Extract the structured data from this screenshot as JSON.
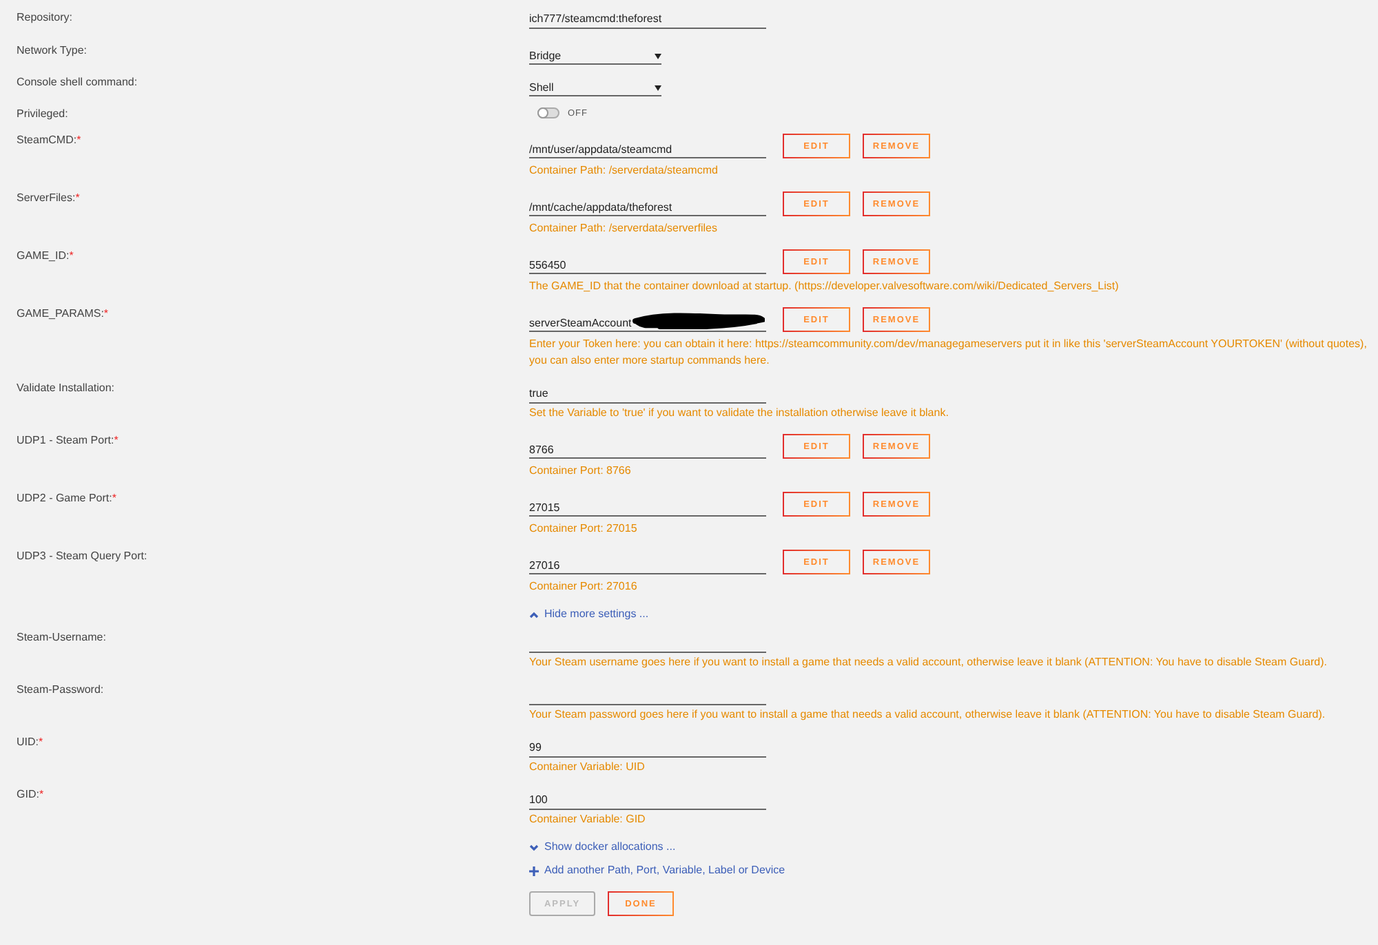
{
  "rows": [
    {
      "kind": "text",
      "label": "Repository:",
      "value": "ich777/steamcmd:theforest"
    },
    {
      "kind": "select",
      "label": "Network Type:",
      "value": "Bridge"
    },
    {
      "kind": "select",
      "label": "Console shell command:",
      "value": "Shell"
    },
    {
      "kind": "toggle",
      "label": "Privileged:",
      "on": false,
      "state_label": "OFF"
    },
    {
      "kind": "path",
      "label": "SteamCMD:",
      "required_mark": "*",
      "value": "/mnt/user/appdata/steamcmd",
      "help": "Container Path: /serverdata/steamcmd",
      "buttons": [
        "EDIT",
        "REMOVE"
      ]
    },
    {
      "kind": "path",
      "label": "ServerFiles:",
      "required_mark": "*",
      "value": "/mnt/cache/appdata/theforest",
      "help": "Container Path: /serverdata/serverfiles",
      "buttons": [
        "EDIT",
        "REMOVE"
      ]
    },
    {
      "kind": "path",
      "label": "GAME_ID:",
      "required_mark": "*",
      "value": "556450",
      "help": "The GAME_ID that the container download at startup. (https://developer.valvesoftware.com/wiki/Dedicated_Servers_List)",
      "buttons": [
        "EDIT",
        "REMOVE"
      ]
    },
    {
      "kind": "path",
      "label": "GAME_PARAMS:",
      "required_mark": "*",
      "value": "serverSteamAccount",
      "redacted": true,
      "help": "Enter your Token here: you can obtain it here: https://steamcommunity.com/dev/managegameservers put it in like this 'serverSteamAccount YOURTOKEN' (without quotes), you can also enter more startup commands here.",
      "buttons": [
        "EDIT",
        "REMOVE"
      ]
    },
    {
      "kind": "variable",
      "label": "Validate Installation:",
      "value": "true",
      "help": "Set the Variable to 'true' if you want to validate the installation otherwise leave it blank."
    },
    {
      "kind": "path",
      "label": "UDP1 - Steam Port:",
      "required_mark": "*",
      "value": "8766",
      "help": "Container Port: 8766",
      "buttons": [
        "EDIT",
        "REMOVE"
      ]
    },
    {
      "kind": "path",
      "label": "UDP2 - Game Port:",
      "required_mark": "*",
      "value": "27015",
      "help": "Container Port: 27015",
      "buttons": [
        "EDIT",
        "REMOVE"
      ]
    },
    {
      "kind": "path",
      "label": "UDP3 - Steam Query Port:",
      "value": "27016",
      "help": "Container Port: 27016",
      "buttons": [
        "EDIT",
        "REMOVE"
      ]
    },
    {
      "kind": "hide-link",
      "label": "Hide more settings ..."
    },
    {
      "kind": "variable",
      "label": "Steam-Username:",
      "help": "Your Steam username goes here if you want to install a game that needs a valid account, otherwise leave it blank (ATTENTION: You have to disable Steam Guard)."
    },
    {
      "kind": "variable",
      "label": "Steam-Password:",
      "help": "Your Steam password goes here if you want to install a game that needs a valid account, otherwise leave it blank (ATTENTION: You have to disable Steam Guard)."
    },
    {
      "kind": "variable",
      "label": "UID:",
      "required_mark": "*",
      "value": "99",
      "help": "Container Variable: UID"
    },
    {
      "kind": "variable",
      "label": "GID:",
      "required_mark": "*",
      "value": "100",
      "help": "Container Variable: GID"
    },
    {
      "kind": "show-link",
      "label": "Show docker allocations ..."
    },
    {
      "kind": "add-link",
      "label": "Add another Path, Port, Variable, Label or Device"
    }
  ],
  "actions": [
    {
      "label": "APPLY",
      "disabled": true
    },
    {
      "label": "DONE",
      "disabled": false
    }
  ]
}
